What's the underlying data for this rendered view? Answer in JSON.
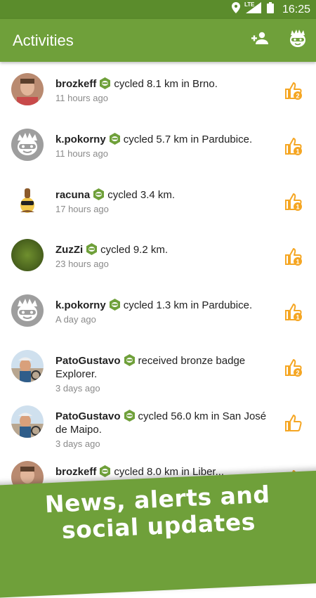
{
  "status": {
    "time": "16:25",
    "network": "LTE"
  },
  "appbar": {
    "title": "Activities"
  },
  "activities": [
    {
      "user": "brozkeff",
      "text": "cycled 8.1 km in Brno.",
      "time": "11 hours ago",
      "likes": "2",
      "avatar": "photo"
    },
    {
      "user": "k.pokorny",
      "text": "cycled 5.7 km in Pardubice.",
      "time": "11 hours ago",
      "likes": "1",
      "avatar": "mascot"
    },
    {
      "user": "racuna",
      "text": "cycled 3.4 km.",
      "time": "17 hours ago",
      "likes": "1",
      "avatar": "cartoon"
    },
    {
      "user": "ZuzZi",
      "text": "cycled 9.2 km.",
      "time": "23 hours ago",
      "likes": "1",
      "avatar": "green"
    },
    {
      "user": "k.pokorny",
      "text": "cycled 1.3 km in Pardubice.",
      "time": "A day ago",
      "likes": "1",
      "avatar": "mascot"
    },
    {
      "user": "PatoGustavo",
      "text": "received bronze badge Explorer.",
      "time": "3 days ago",
      "likes": "2",
      "avatar": "cyclist"
    },
    {
      "user": "PatoGustavo",
      "text": "cycled 56.0 km in San José de Maipo.",
      "time": "3 days ago",
      "likes": "",
      "avatar": "cyclist"
    },
    {
      "user": "brozkeff",
      "text": "cycled 8.0 km in Liber...",
      "time": "",
      "likes": "",
      "avatar": "photo"
    }
  ],
  "banner": {
    "line1": "News, alerts and",
    "line2": "social updates"
  },
  "colors": {
    "primary": "#6fa03a",
    "dark": "#5b8c2c",
    "accent": "#f5a623"
  }
}
